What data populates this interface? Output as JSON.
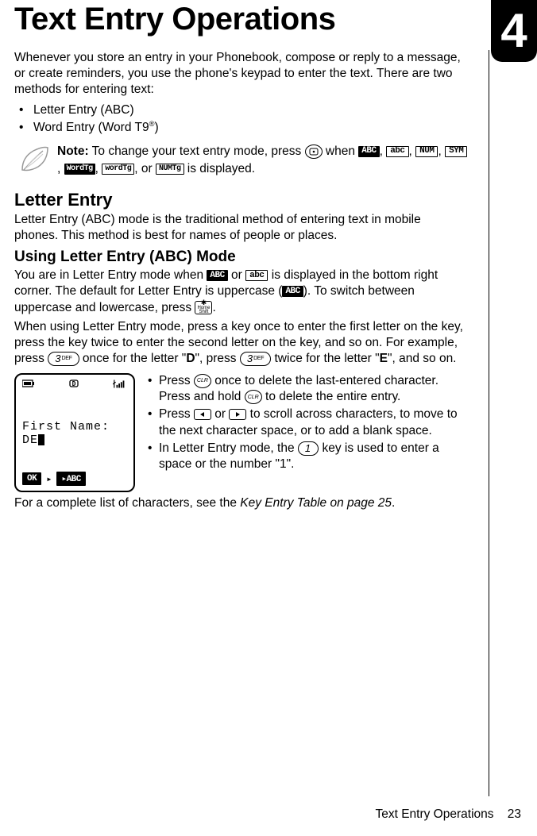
{
  "chapter_number": "4",
  "title": "Text Entry Operations",
  "intro": "Whenever you store an entry in your Phonebook, compose or reply to a message, or create reminders, you use the phone's keypad to enter the text. There are two methods for entering text:",
  "methods": [
    "Letter Entry (ABC)",
    "Word Entry (Word T9"
  ],
  "methods_suffix": ")",
  "reg_mark": "®",
  "note_label": "Note:",
  "note_part1": " To change your text entry mode, press ",
  "note_part2": " when ",
  "note_part3": ", or ",
  "note_part4": " is displayed.",
  "mode_labels": {
    "ABC_upper": "ABC",
    "abc_lower": "abc",
    "NUM": "NUM",
    "SYM": "SYM",
    "WordTg_u": "WordTg",
    "wordtg_l": "wordTg",
    "NUMTg": "NUMTg"
  },
  "section_letter_entry": "Letter Entry",
  "letter_entry_body": "Letter Entry (ABC) mode is the traditional method of entering text in mobile phones. This method is best for names of people or places.",
  "subsection_using": "Using Letter Entry (ABC) Mode",
  "using_p1_a": "You are in Letter Entry mode when ",
  "using_p1_b": " or ",
  "using_p1_c": " is displayed in the bottom right corner. The default for Letter Entry is uppercase (",
  "using_p1_d": "). To switch between uppercase and lowercase, press ",
  "using_p1_e": ".",
  "using_p2_a": "When using Letter Entry mode, press a key once to enter the first letter on the key, press the key twice to enter the second letter on the key, and so on. For example, press ",
  "using_p2_b": " once for the letter \"",
  "using_p2_c": "\", press ",
  "using_p2_d": " twice for the letter \"",
  "using_p2_e": "\", and so on.",
  "letter_D": "D",
  "letter_E": "E",
  "screen": {
    "first_name_label": "First Name:",
    "entered": "DE",
    "ok": "OK",
    "mode": "ABC"
  },
  "bullets": {
    "b1a": "Press ",
    "b1b": " once to delete the last-entered character. Press and hold ",
    "b1c": " to delete the entire entry.",
    "b2a": "Press ",
    "b2b": " or ",
    "b2c": " to scroll across characters, to move to the next character space, or to add a blank space.",
    "b3a": "In Letter Entry mode, the ",
    "b3b": " key is used to enter a space or the number \"1\"."
  },
  "closing": "For a complete list of characters, see the ",
  "closing_ref": "Key Entry Table on page 25",
  "closing_end": ".",
  "footer_text": "Text Entry Operations",
  "footer_page": "23",
  "keys": {
    "menu": "⎈",
    "three_def_num": "3",
    "three_def_lbl": "DEF",
    "clr": "CLR",
    "one": "1",
    "star_home": "Home",
    "star_shift": "Shift"
  }
}
